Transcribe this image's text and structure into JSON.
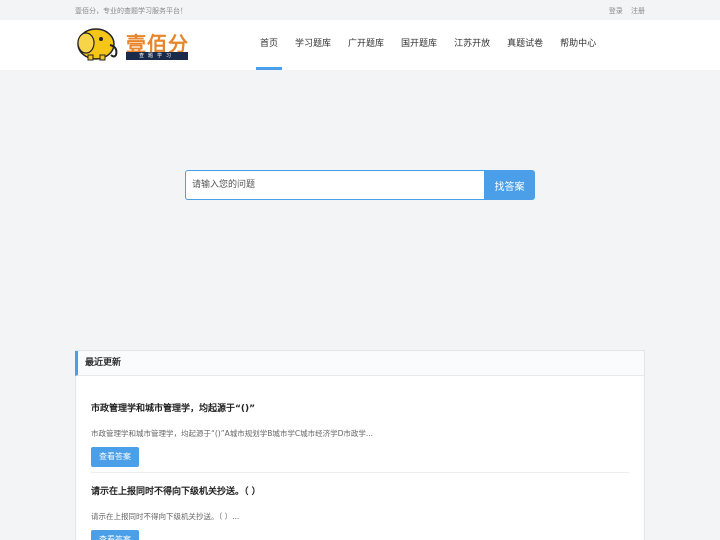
{
  "topbar": {
    "slogan": "壹佰分，专业的查题学习服务平台！",
    "login": "登录",
    "register": "注册"
  },
  "logo": {
    "brand": "壹佰分",
    "tagline": "查题学习"
  },
  "nav": {
    "items": [
      {
        "label": "首页",
        "active": true
      },
      {
        "label": "学习题库"
      },
      {
        "label": "广开题库"
      },
      {
        "label": "国开题库"
      },
      {
        "label": "江苏开放"
      },
      {
        "label": "真题试卷"
      },
      {
        "label": "帮助中心"
      }
    ]
  },
  "search": {
    "placeholder": "请输入您的问题",
    "button": "找答案"
  },
  "recent": {
    "heading": "最近更新",
    "entries": [
      {
        "title": "市政管理学和城市管理学，均起源于“()”",
        "desc": "市政管理学和城市管理学，均起源于“()”A城市规划学B城市学C城市经济学D市政学...",
        "button": "查看答案"
      },
      {
        "title": "请示在上报同时不得向下级机关抄送。（   ）",
        "desc": "请示在上报同时不得向下级机关抄送。（   ）...",
        "button": "查看答案"
      }
    ]
  },
  "colors": {
    "accent": "#4a9fe8",
    "brand": "#e8852b",
    "background": "#f3f4f6"
  }
}
